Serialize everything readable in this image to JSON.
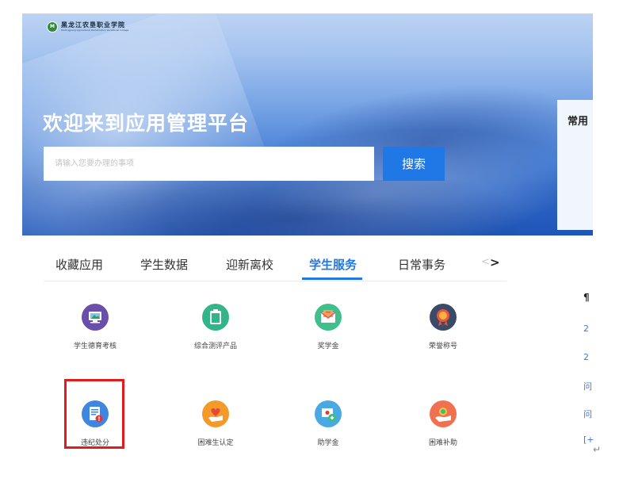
{
  "logo": {
    "mark": "M",
    "name": "黑龙江农垦职业学院",
    "sub": "Heilongjiang Agricultural Reclamation Vocational College"
  },
  "hero": {
    "title": "欢迎来到应用管理平台",
    "search_placeholder": "请输入您要办理的事项",
    "search_button": "搜索",
    "right_card_title": "常用"
  },
  "tabs": [
    {
      "label": "收藏应用",
      "active": false
    },
    {
      "label": "学生数据",
      "active": false
    },
    {
      "label": "迎新离校",
      "active": false
    },
    {
      "label": "学生服务",
      "active": true
    },
    {
      "label": "日常事务",
      "active": false
    }
  ],
  "tab_nav": {
    "prev": "<",
    "next": ">"
  },
  "apps": [
    {
      "label": "学生德育考核",
      "icon": "monitor-icon",
      "color": "#6a4ea8"
    },
    {
      "label": "综合测评产品",
      "icon": "clipboard-icon",
      "color": "#33b58a"
    },
    {
      "label": "奖学金",
      "icon": "envelope-icon",
      "color": "#3fbf8c"
    },
    {
      "label": "荣誉称号",
      "icon": "medal-icon",
      "color": "#3b4a66"
    },
    {
      "label": "违纪处分",
      "icon": "document-warning-icon",
      "color": "#3f86e0"
    },
    {
      "label": "困难生认定",
      "icon": "heart-hand-icon",
      "color": "#f39a2a"
    },
    {
      "label": "助学金",
      "icon": "card-icon",
      "color": "#4aa9e3"
    },
    {
      "label": "困难补助",
      "icon": "coin-hand-icon",
      "color": "#f07050"
    }
  ],
  "right_list": {
    "head": "¶",
    "items": [
      "2",
      "2",
      "问",
      "问",
      "[+"
    ]
  },
  "return_mark": "↵"
}
